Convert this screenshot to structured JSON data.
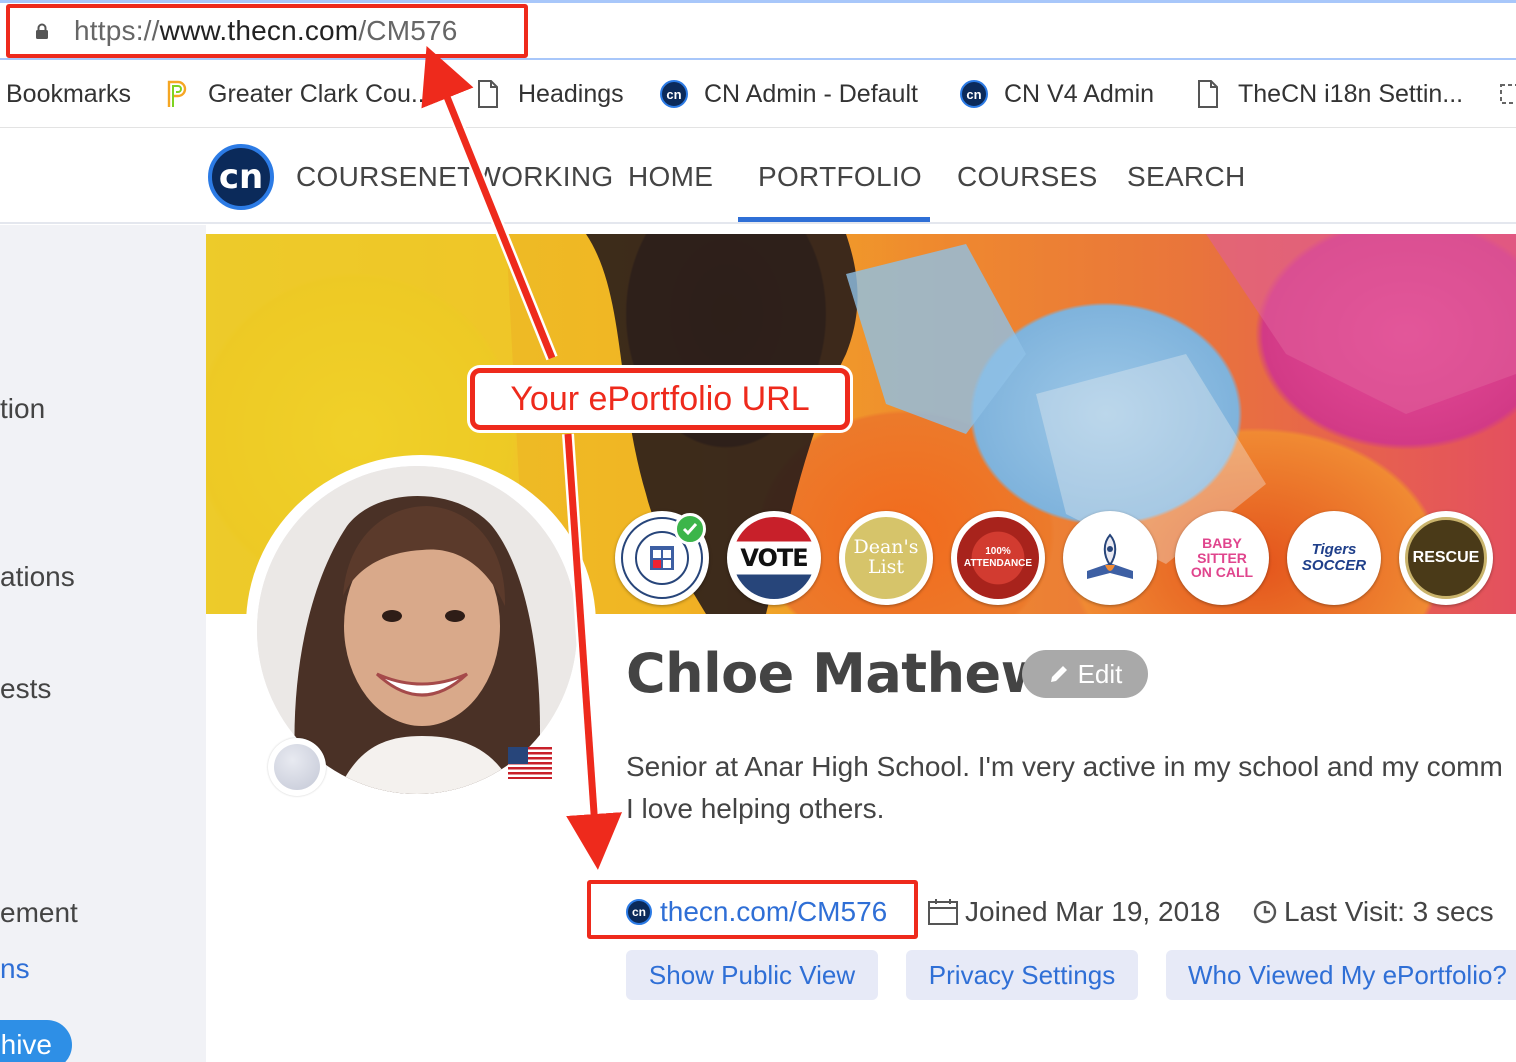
{
  "browser": {
    "url": {
      "prefix": "https://",
      "host": "www.thecn.com",
      "path": "/CM576"
    },
    "bookmarks": [
      {
        "label": "Bookmarks",
        "icon": "none"
      },
      {
        "label": "Greater Clark Cou...",
        "icon": "powerschool-icon"
      },
      {
        "label": "Headings",
        "icon": "page-icon"
      },
      {
        "label": "CN Admin - Default",
        "icon": "cn-icon"
      },
      {
        "label": "CN V4 Admin",
        "icon": "cn-icon"
      },
      {
        "label": "TheCN i18n Settin...",
        "icon": "page-icon"
      }
    ]
  },
  "site": {
    "logo_text": "cn",
    "nav": [
      "COURSENETWORKING",
      "HOME",
      "PORTFOLIO",
      "COURSES",
      "SEARCH"
    ],
    "active_nav": "PORTFOLIO"
  },
  "sidebar": {
    "items": [
      "tion",
      "ations",
      "ests",
      "ement",
      "ns"
    ],
    "pill_label": "hive"
  },
  "badges": [
    {
      "name": "university-badge",
      "label": "",
      "verified": true
    },
    {
      "name": "vote-badge",
      "label": "VOTE"
    },
    {
      "name": "deans-list-badge",
      "label": "Dean's List"
    },
    {
      "name": "attendance-badge",
      "label": "100% ATTENDANCE"
    },
    {
      "name": "rocket-book-badge",
      "label": ""
    },
    {
      "name": "babysitter-badge",
      "label": "BABY SITTER ON CALL"
    },
    {
      "name": "tigers-soccer-badge",
      "label": "Tigers SOCCER"
    },
    {
      "name": "rescue-badge",
      "label": "RESCUE"
    }
  ],
  "profile": {
    "name": "Chloe Mathews",
    "edit_label": "Edit",
    "bio_line1": "Senior at Anar High School. I'm very active in my school and my comm",
    "bio_line2": "I love helping others.",
    "portfolio_url": "thecn.com/CM576",
    "joined": "Joined Mar 19, 2018",
    "last_visit": "Last Visit: 3 secs"
  },
  "actions": [
    "Show Public View",
    "Privacy Settings",
    "Who Viewed My ePortfolio?"
  ],
  "annotation": {
    "callout": "Your ePortfolio URL",
    "color": "#ee2a1c"
  },
  "colors": {
    "accent": "#2f6fd6",
    "annotation": "#ee2a1c",
    "cn_navy": "#0b2a5a"
  }
}
